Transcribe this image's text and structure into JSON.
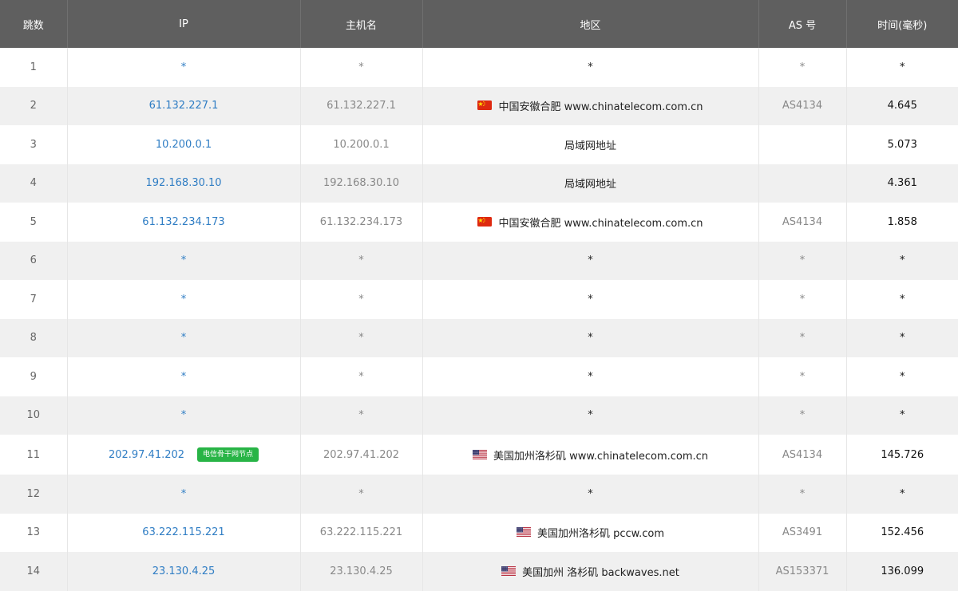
{
  "table": {
    "headers": [
      "跳数",
      "IP",
      "主机名",
      "地区",
      "AS 号",
      "时间(毫秒)"
    ],
    "rows": [
      {
        "hop": "1",
        "ip": "*",
        "host": "*",
        "loc": "*",
        "flag": "",
        "as": "*",
        "time": "*",
        "badge": ""
      },
      {
        "hop": "2",
        "ip": "61.132.227.1",
        "host": "61.132.227.1",
        "loc": "中国安徽合肥 www.chinatelecom.com.cn",
        "flag": "cn",
        "as": "AS4134",
        "time": "4.645",
        "badge": ""
      },
      {
        "hop": "3",
        "ip": "10.200.0.1",
        "host": "10.200.0.1",
        "loc": "局域网地址",
        "flag": "",
        "as": "",
        "time": "5.073",
        "badge": ""
      },
      {
        "hop": "4",
        "ip": "192.168.30.10",
        "host": "192.168.30.10",
        "loc": "局域网地址",
        "flag": "",
        "as": "",
        "time": "4.361",
        "badge": ""
      },
      {
        "hop": "5",
        "ip": "61.132.234.173",
        "host": "61.132.234.173",
        "loc": "中国安徽合肥 www.chinatelecom.com.cn",
        "flag": "cn",
        "as": "AS4134",
        "time": "1.858",
        "badge": ""
      },
      {
        "hop": "6",
        "ip": "*",
        "host": "*",
        "loc": "*",
        "flag": "",
        "as": "*",
        "time": "*",
        "badge": ""
      },
      {
        "hop": "7",
        "ip": "*",
        "host": "*",
        "loc": "*",
        "flag": "",
        "as": "*",
        "time": "*",
        "badge": ""
      },
      {
        "hop": "8",
        "ip": "*",
        "host": "*",
        "loc": "*",
        "flag": "",
        "as": "*",
        "time": "*",
        "badge": ""
      },
      {
        "hop": "9",
        "ip": "*",
        "host": "*",
        "loc": "*",
        "flag": "",
        "as": "*",
        "time": "*",
        "badge": ""
      },
      {
        "hop": "10",
        "ip": "*",
        "host": "*",
        "loc": "*",
        "flag": "",
        "as": "*",
        "time": "*",
        "badge": ""
      },
      {
        "hop": "11",
        "ip": "202.97.41.202",
        "host": "202.97.41.202",
        "loc": "美国加州洛杉矶 www.chinatelecom.com.cn",
        "flag": "us",
        "as": "AS4134",
        "time": "145.726",
        "badge": "电信骨干网节点"
      },
      {
        "hop": "12",
        "ip": "*",
        "host": "*",
        "loc": "*",
        "flag": "",
        "as": "*",
        "time": "*",
        "badge": ""
      },
      {
        "hop": "13",
        "ip": "63.222.115.221",
        "host": "63.222.115.221",
        "loc": "美国加州洛杉矶 pccw.com",
        "flag": "us",
        "as": "AS3491",
        "time": "152.456",
        "badge": ""
      },
      {
        "hop": "14",
        "ip": "23.130.4.25",
        "host": "23.130.4.25",
        "loc": "美国加州 洛杉矶 backwaves.net",
        "flag": "us",
        "as": "AS153371",
        "time": "136.099",
        "badge": ""
      }
    ]
  },
  "colors": {
    "header_bg": "#5f5f5f",
    "ip_link": "#2f7dc4",
    "badge_bg": "#28b446",
    "row_alt": "#f0f0f0"
  },
  "icons": {
    "cn": "china-flag-icon",
    "us": "usa-flag-icon"
  }
}
